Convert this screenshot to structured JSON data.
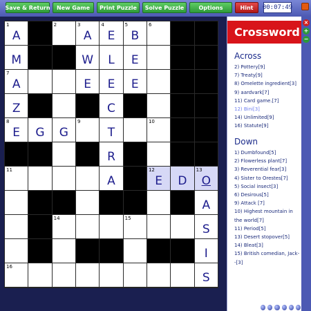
{
  "toolbar": {
    "buttons": [
      {
        "label": "Save & Return"
      },
      {
        "label": "New Game"
      },
      {
        "label": "Print Puzzle"
      },
      {
        "label": "Solve Puzzle"
      },
      {
        "label": "Options"
      },
      {
        "label": "Hint"
      }
    ],
    "timer": "00:07:49"
  },
  "panel": {
    "title": "Crossword",
    "across_heading": "Across",
    "down_heading": "Down",
    "across": [
      "2) Pottery[9]",
      "7) Treaty[9]",
      "8) Omelette ingredient[3]",
      "9) aardvark[7]",
      "11) Card game.[7]",
      "12) Bini[3]",
      "14) Unlimited[9]",
      "16) Statute[9]"
    ],
    "down": [
      "1) Dumbfound[5]",
      "2) Flowerless plant[7]",
      "3) Reverential fear[3]",
      "4) Sister to Orestes[7]",
      "5) Social insect[3]",
      "6) Desirous[5]",
      "9) Attack [7]",
      "10) Highest mountain in the world[7]",
      "11) Period[5]",
      "13) Desert stopover[5]",
      "14) Bleat[3]",
      "15) British comedian, Jack--[3]"
    ],
    "selected_across_index": 5
  },
  "grid": {
    "rows": 11,
    "cols": 9,
    "cells": [
      [
        {
          "n": "1",
          "l": "A"
        },
        {
          "b": 1
        },
        {
          "n": "2"
        },
        {
          "n": "3",
          "l": "A"
        },
        {
          "n": "4",
          "l": "E"
        },
        {
          "n": "5",
          "l": "B"
        },
        {
          "n": "6"
        },
        {
          "b": 1
        },
        {
          "b": 1
        }
      ],
      [
        {
          "l": "M"
        },
        {
          "b": 1
        },
        {
          "b": 1
        },
        {
          "l": "W"
        },
        {
          "l": "L"
        },
        {
          "l": "E"
        },
        {},
        {
          "b": 1
        },
        {
          "b": 1
        }
      ],
      [
        {
          "n": "7",
          "l": "A"
        },
        {},
        {},
        {
          "l": "E"
        },
        {
          "l": "E"
        },
        {
          "l": "E"
        },
        {},
        {
          "b": 1
        },
        {
          "b": 1
        }
      ],
      [
        {
          "l": "Z"
        },
        {
          "b": 1
        },
        {},
        {
          "b": 1
        },
        {
          "l": "C"
        },
        {
          "b": 1
        },
        {},
        {
          "b": 1
        },
        {
          "b": 1
        }
      ],
      [
        {
          "n": "8",
          "l": "E"
        },
        {
          "l": "G"
        },
        {
          "l": "G"
        },
        {
          "n": "9"
        },
        {
          "l": "T"
        },
        {},
        {
          "n": "10"
        },
        {
          "b": 1
        },
        {
          "b": 1
        }
      ],
      [
        {
          "b": 1
        },
        {
          "b": 1
        },
        {},
        {
          "b": 1
        },
        {
          "l": "R"
        },
        {
          "b": 1
        },
        {},
        {
          "b": 1
        },
        {
          "b": 1
        }
      ],
      [
        {
          "n": "11"
        },
        {},
        {},
        {},
        {
          "l": "A"
        },
        {
          "b": 1
        },
        {
          "n": "12",
          "l": "E",
          "h": 1
        },
        {
          "l": "D",
          "h": 1
        },
        {
          "n": "13",
          "l": "O",
          "h": 1,
          "u": 1
        }
      ],
      [
        {},
        {
          "b": 1
        },
        {
          "b": 1
        },
        {},
        {
          "b": 1
        },
        {
          "b": 1
        },
        {},
        {
          "b": 1
        },
        {
          "l": "A"
        }
      ],
      [
        {},
        {
          "b": 1
        },
        {
          "n": "14"
        },
        {},
        {},
        {
          "n": "15"
        },
        {},
        {},
        {
          "l": "S"
        }
      ],
      [
        {},
        {
          "b": 1
        },
        {},
        {
          "b": 1
        },
        {
          "b": 1
        },
        {},
        {
          "b": 1
        },
        {
          "b": 1
        },
        {
          "l": "I"
        }
      ],
      [
        {
          "n": "16"
        },
        {},
        {},
        {},
        {},
        {},
        {},
        {},
        {
          "l": "S"
        }
      ]
    ]
  },
  "colors": {
    "toolbar": "#4c59b3",
    "button_green": "#2e9a3a",
    "hint_red": "#b01818",
    "panel_header": "#d8141a",
    "letter": "#1c1c8c",
    "highlight": "#d6d8f6"
  },
  "icons": [
    "app-window-icon",
    "cursor-icon",
    "close-icon",
    "plus-icon",
    "minus-icon",
    "media-button-icon"
  ]
}
